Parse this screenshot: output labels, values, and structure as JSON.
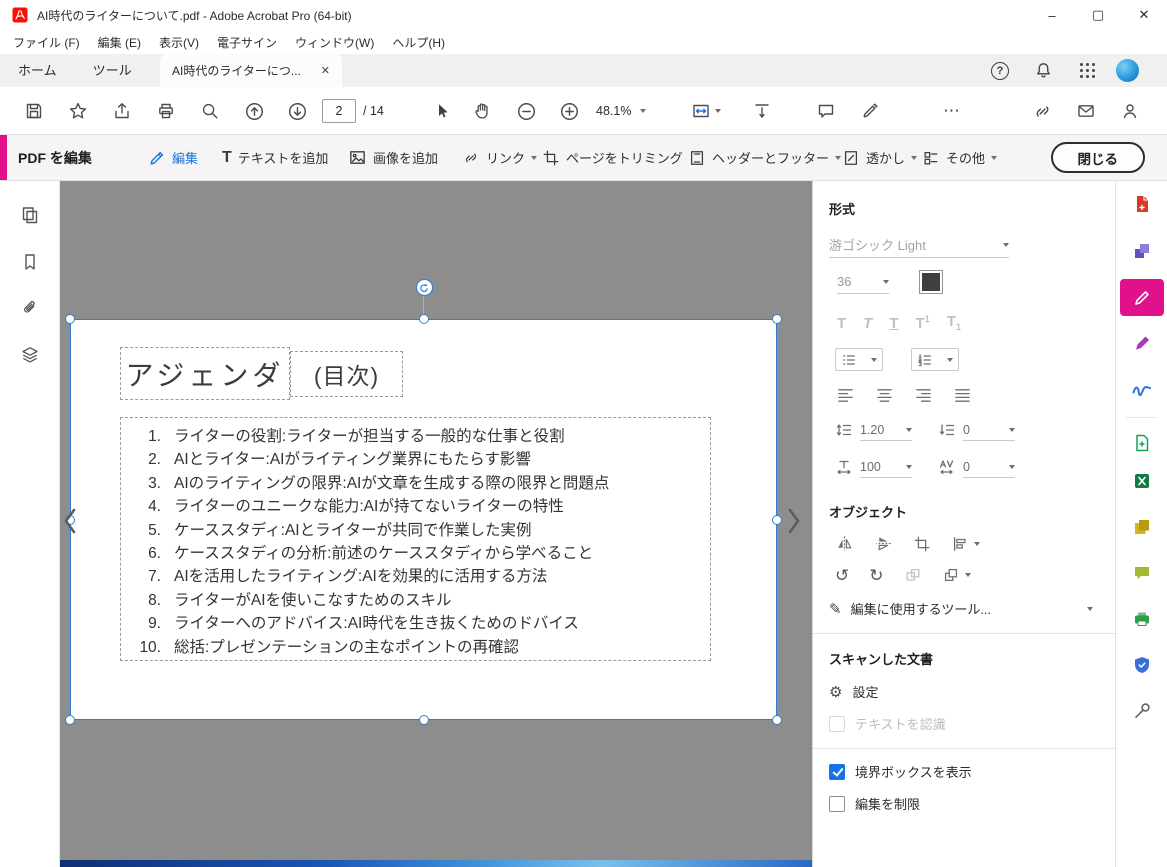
{
  "titlebar": {
    "title": "AI時代のライターについて.pdf - Adobe Acrobat Pro (64-bit)",
    "minimize_glyph": "–",
    "maximize_glyph": "▢",
    "close_glyph": "✕"
  },
  "menubar": {
    "items": [
      "ファイル (F)",
      "編集 (E)",
      "表示(V)",
      "電子サイン",
      "ウィンドウ(W)",
      "ヘルプ(H)"
    ]
  },
  "tabbar": {
    "home": "ホーム",
    "tools": "ツール",
    "doc_tab": "AI時代のライターにつ...",
    "tab_close_glyph": "✕",
    "help_glyph": "?"
  },
  "toolbar": {
    "page_number": "2",
    "page_total": "/ 14",
    "zoom_value": "48.1%",
    "more_glyph": "⋯"
  },
  "edit_bar": {
    "panel_title": "PDF を編集",
    "edit": "編集",
    "add_text": "テキストを追加",
    "add_text_glyph": "T",
    "add_image": "画像を追加",
    "link": "リンク",
    "crop_pages": "ページをトリミング",
    "header_footer": "ヘッダーとフッター",
    "watermark": "透かし",
    "more": "その他",
    "close_button": "閉じる"
  },
  "document": {
    "title_main": "アジェンダ",
    "title_sub": "(目次)",
    "items": [
      {
        "n": "1.",
        "t": "ライターの役割:ライターが担当する一般的な仕事と役割"
      },
      {
        "n": "2.",
        "t": "AIとライター:AIがライティング業界にもたらす影響"
      },
      {
        "n": "3.",
        "t": "AIのライティングの限界:AIが文章を生成する際の限界と問題点"
      },
      {
        "n": "4.",
        "t": "ライターのユニークな能力:AIが持てないライターの特性"
      },
      {
        "n": "5.",
        "t": "ケーススタディ:AIとライターが共同で作業した実例"
      },
      {
        "n": "6.",
        "t": "ケーススタディの分析:前述のケーススタディから学べること"
      },
      {
        "n": "7.",
        "t": "AIを活用したライティング:AIを効果的に活用する方法"
      },
      {
        "n": "8.",
        "t": "ライターがAIを使いこなすためのスキル"
      },
      {
        "n": "9.",
        "t": "ライターへのアドバイス:AI時代を生き抜くためのドバイス"
      },
      {
        "n": "10.",
        "t": "総括:プレゼンテーションの主なポイントの再確認"
      }
    ]
  },
  "format_panel": {
    "section_format": "形式",
    "font_name": "游ゴシック Light",
    "font_size": "36",
    "style_t": "T",
    "sup_mark": "1",
    "sub_mark": "1",
    "line_spacing": "1.20",
    "para_spacing": "0",
    "h_scale": "100",
    "char_spacing": "0",
    "section_objects": "オブジェクト",
    "rotate_ccw_glyph": "↺",
    "rotate_cw_glyph": "↻",
    "pencil_glyph": "✎",
    "edit_tools_label": "編集に使用するツール...",
    "section_scanned": "スキャンした文書",
    "gear_glyph": "⚙",
    "settings_label": "設定",
    "recognize_text_label": "テキストを認識",
    "show_bounding_box_label": "境界ボックスを表示",
    "restrict_editing_label": "編集を制限"
  },
  "colors": {
    "accent_pink": "#e0118b",
    "accent_blue": "#1473e6",
    "selection_blue": "#2e7fd1",
    "doc_background": "#8d8d8d"
  }
}
